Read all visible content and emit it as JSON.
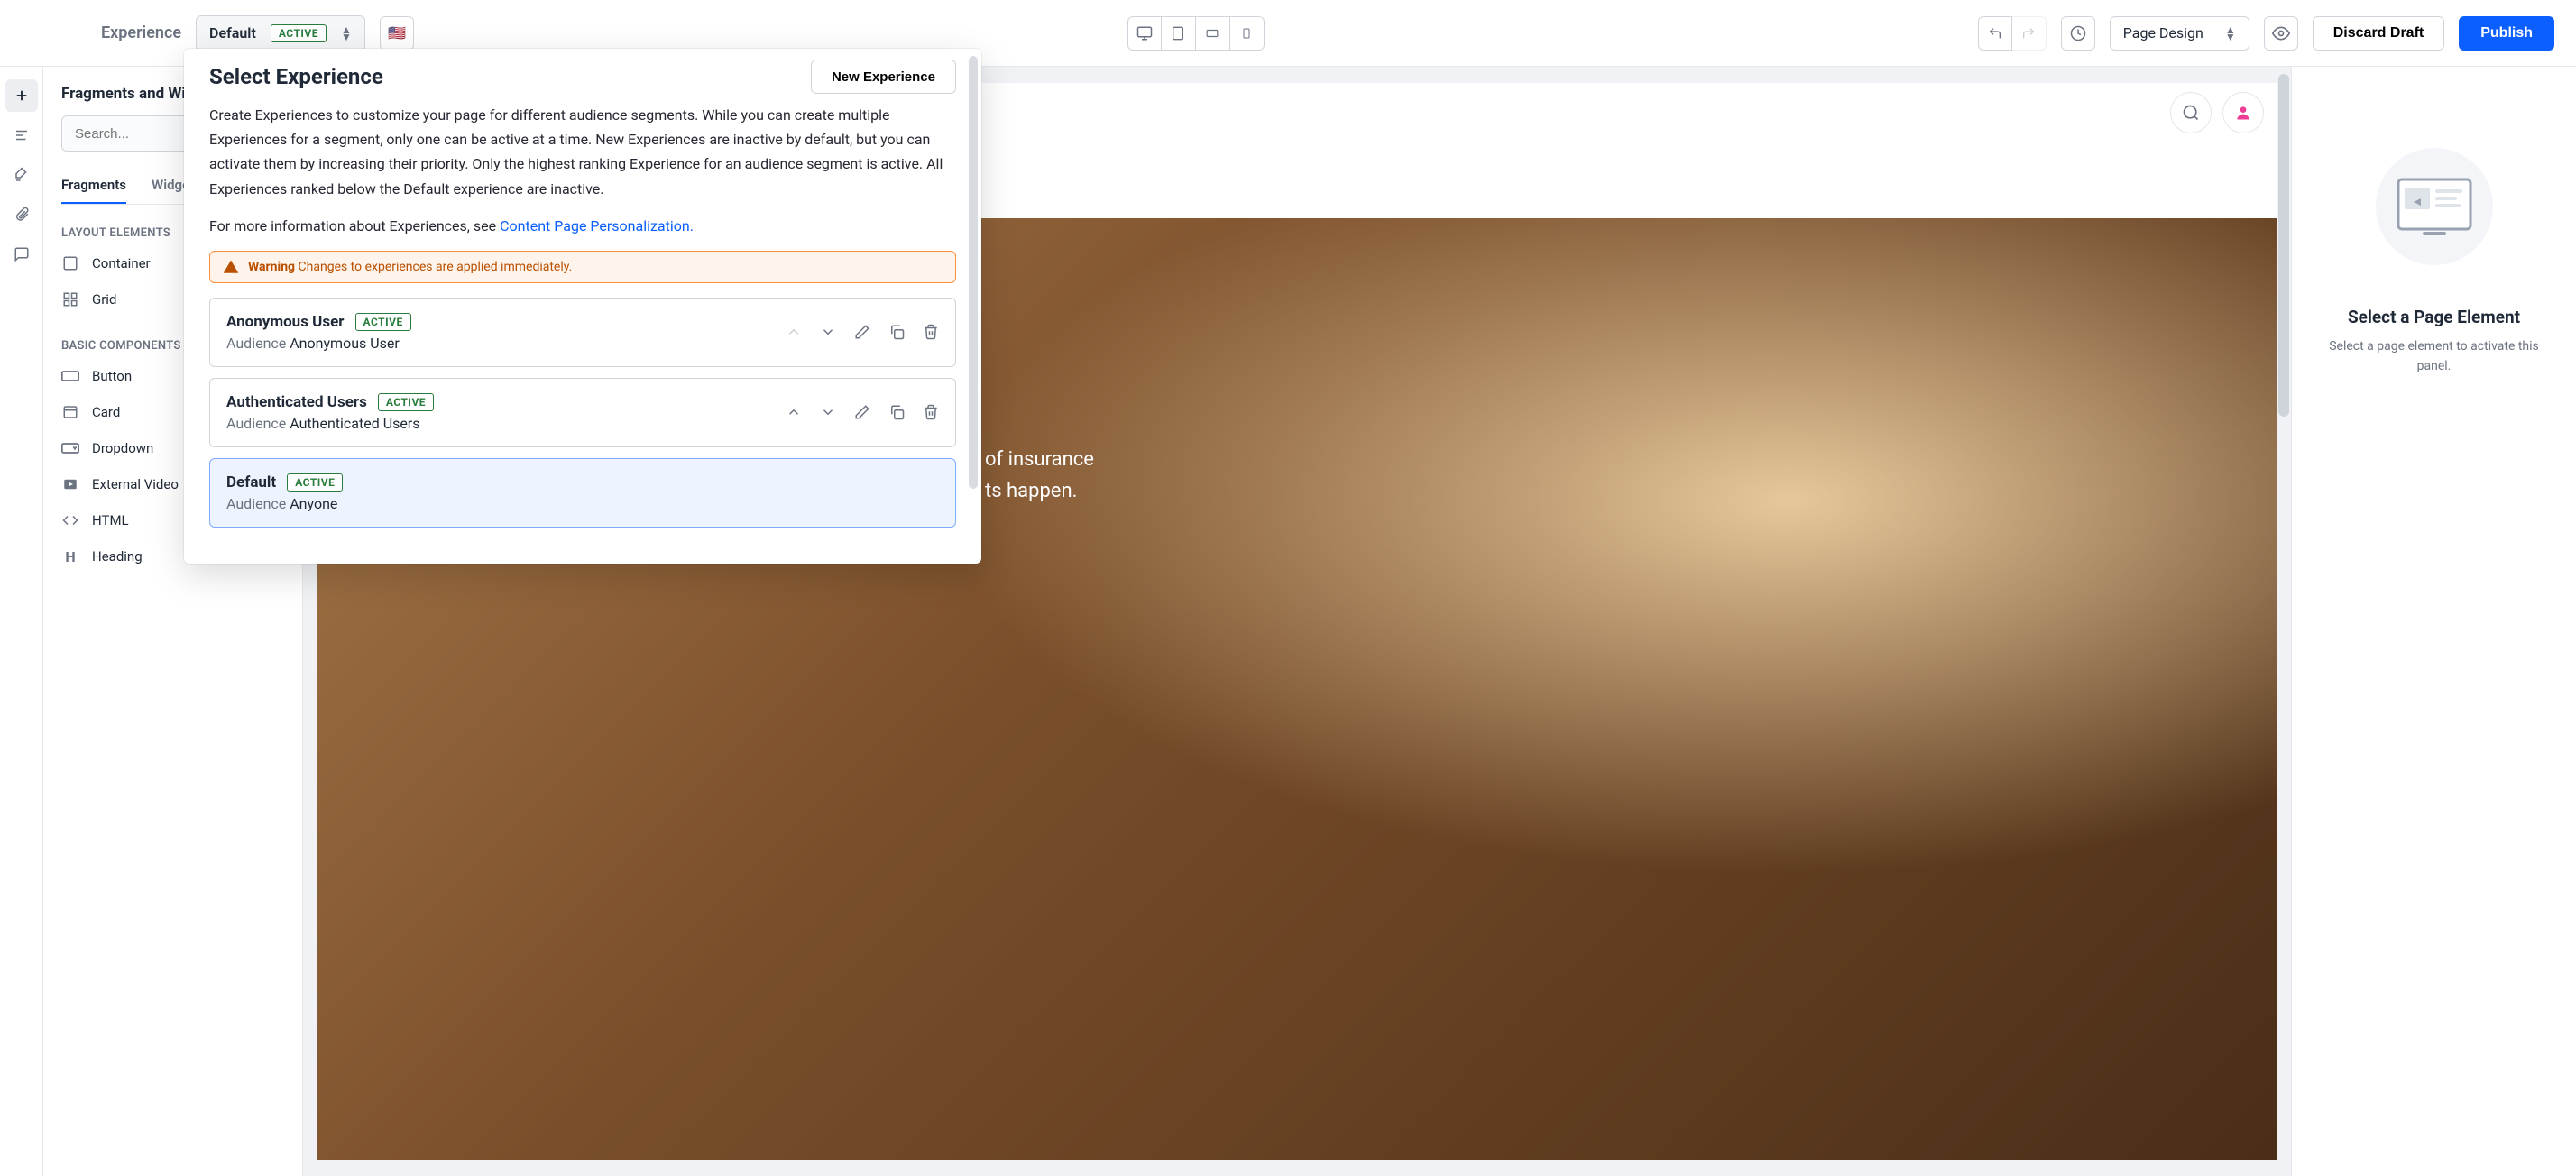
{
  "toolbar": {
    "experience_label": "Experience",
    "current_experience": "Default",
    "active_badge": "ACTIVE",
    "page_mode": "Page Design",
    "discard": "Discard Draft",
    "publish": "Publish"
  },
  "side_panel": {
    "title": "Fragments and Widgets",
    "search_placeholder": "Search...",
    "tabs": {
      "fragments": "Fragments",
      "widgets": "Widgets"
    },
    "section_layout": "LAYOUT ELEMENTS",
    "layout_items": [
      "Container",
      "Grid"
    ],
    "section_basic": "BASIC COMPONENTS",
    "basic_items": [
      "Button",
      "Card",
      "Dropdown",
      "External Video",
      "HTML",
      "Heading"
    ]
  },
  "right_panel": {
    "title": "Select a Page Element",
    "desc": "Select a page element to activate this panel."
  },
  "hero": {
    "line1": "of insurance",
    "line2": "ts happen."
  },
  "popover": {
    "title": "Select Experience",
    "new_btn": "New Experience",
    "desc_prefix": "Create Experiences to customize your page for different audience segments. While you can create multiple Experiences for a segment, only one can be active at a time. New Experiences are inactive by default, but you can activate them by increasing their priority. Only the highest ranking Experience for an audience segment is active. All Experiences ranked below the Default experience are inactive.",
    "desc_more": "For more information about Experiences, see ",
    "desc_link": "Content Page Personalization.",
    "warning_label": "Warning",
    "warning_text": "Changes to experiences are applied immediately.",
    "audience_label": "Audience",
    "experiences": [
      {
        "name": "Anonymous User",
        "badge": "ACTIVE",
        "audience": "Anonymous User",
        "up_disabled": true,
        "selected": false
      },
      {
        "name": "Authenticated Users",
        "badge": "ACTIVE",
        "audience": "Authenticated Users",
        "up_disabled": false,
        "selected": false
      },
      {
        "name": "Default",
        "badge": "ACTIVE",
        "audience": "Anyone",
        "up_disabled": false,
        "selected": true,
        "no_actions": true
      }
    ]
  }
}
